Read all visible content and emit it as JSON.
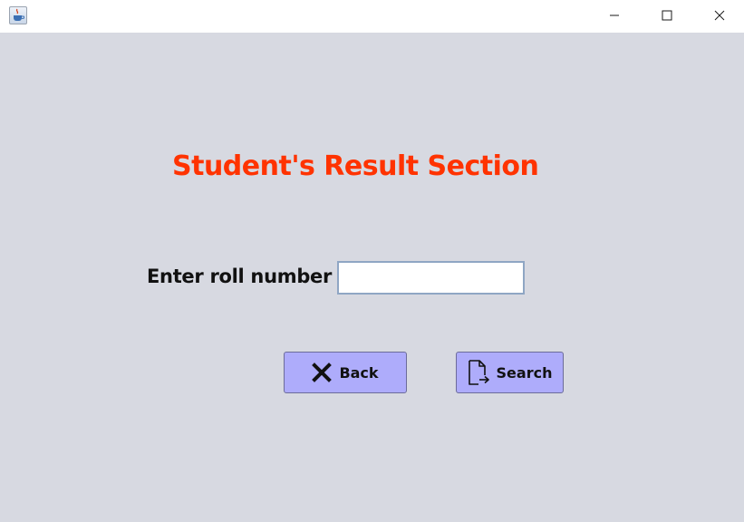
{
  "window": {
    "app_icon": "java-cup-icon",
    "controls": {
      "minimize_icon": "minimize-icon",
      "maximize_icon": "maximize-icon",
      "close_icon": "close-icon"
    }
  },
  "form": {
    "title": "Student's Result Section",
    "title_color": "#ff3300",
    "roll_label": "Enter roll number",
    "roll_value": "",
    "back_label": "Back",
    "back_icon": "x-icon",
    "search_label": "Search",
    "search_icon": "document-export-icon",
    "button_color": "#aeacfb",
    "background_color": "#d7d9e1"
  }
}
